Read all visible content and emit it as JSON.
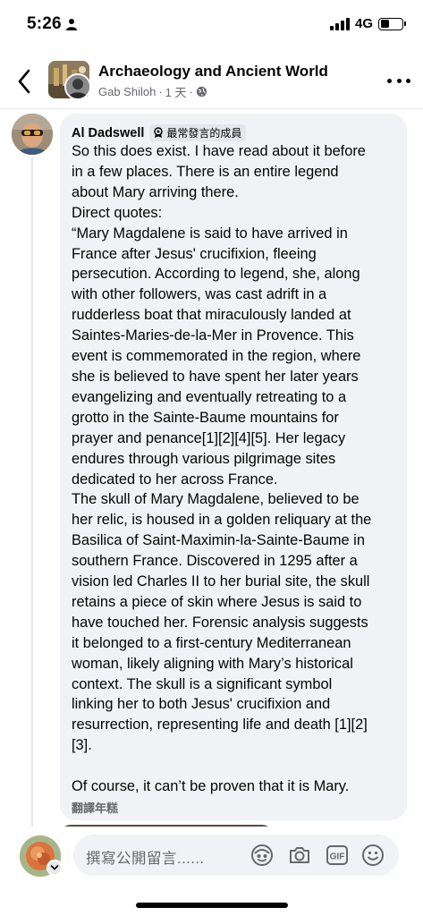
{
  "status_bar": {
    "time": "5:26",
    "network": "4G"
  },
  "header": {
    "group_title": "Archaeology and Ancient World",
    "poster_name": "Gab Shiloh",
    "post_time": "1 天",
    "separator": "·"
  },
  "comment": {
    "author": "Al Dadswell",
    "badge_label": "最常發言的成員",
    "text": "So this does exist.  I have read about it before\nin a few places.  There is an entire legend\nabout Mary arriving there.\nDirect quotes:\n“Mary Magdalene is said to have arrived in\nFrance after Jesus' crucifixion, fleeing\npersecution. According to legend, she, along\nwith other followers, was cast adrift in a\nrudderless boat that miraculously landed at\nSaintes-Maries-de-la-Mer in Provence. This\nevent is commemorated in the region, where\nshe is believed to have spent her later years\nevangelizing and eventually retreating to a\ngrotto in the Sainte-Baume mountains for\nprayer and penance[1][2][4][5]. Her legacy\nendures through various pilgrimage sites\ndedicated to her across France.\nThe skull of Mary Magdalene, believed to be\nher relic, is housed in a golden reliquary at the\nBasilica of Saint-Maximin-la-Sainte-Baume in\nsouthern France. Discovered in 1295 after a\nvision led Charles II to her burial site, the skull\nretains a piece of skin where Jesus is said to\nhave touched her. Forensic analysis suggests\nit belonged to a first-century Mediterranean\nwoman, likely aligning with Mary’s historical\ncontext. The skull is a significant symbol\nlinking her to both Jesus' crucifixion and\nresurrection, representing life and death [1][2]\n[3].\n\nOf course, it can’t be proven that it is Mary.",
    "translate_label": "翻譯年糕"
  },
  "composer": {
    "placeholder": "撰寫公開留言......"
  },
  "icons": {
    "back": "chevron-left-icon",
    "more": "more-horizontal-icon",
    "globe": "globe-icon",
    "badge": "top-contributor-icon",
    "avatar_frame": "avatar-frame-icon",
    "camera": "camera-icon",
    "gif": "gif-icon",
    "emoji": "emoji-icon"
  },
  "colors": {
    "bubble_bg": "#f0f2f5",
    "secondary_text": "#65676b",
    "primary_text": "#050505"
  }
}
